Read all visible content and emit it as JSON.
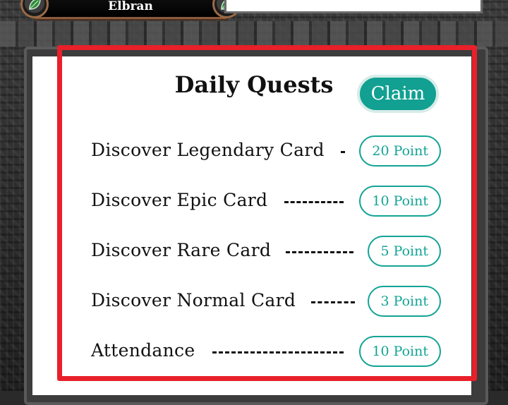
{
  "banner": {
    "name": "Elbran",
    "left_icon": "leaf-icon",
    "right_icon": "leaf-icon"
  },
  "quests_panel": {
    "title": "Daily Quests",
    "claim_label": "Claim",
    "accent_color": "#11a091",
    "highlight_color": "#e8202a",
    "quests": [
      {
        "label": "Discover Legendary Card",
        "points": "20 Point"
      },
      {
        "label": "Discover Epic Card",
        "points": "10 Point"
      },
      {
        "label": "Discover Rare Card",
        "points": "5 Point"
      },
      {
        "label": "Discover Normal Card",
        "points": "3 Point"
      },
      {
        "label": "Attendance",
        "points": "10 Point"
      }
    ]
  }
}
